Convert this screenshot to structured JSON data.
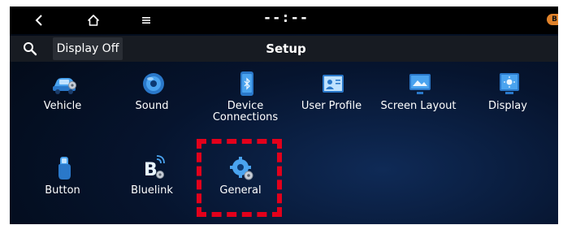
{
  "status_bar": {
    "clock": "--:--",
    "back_icon": "back-chevron-icon",
    "home_icon": "home-icon",
    "menu_icon": "menu-icon",
    "status_icon_letter": "B"
  },
  "title_bar": {
    "search_icon": "search-icon",
    "display_off_label": "Display Off",
    "title": "Setup"
  },
  "menu": {
    "items": [
      {
        "label": "Vehicle",
        "icon": "vehicle-icon"
      },
      {
        "label": "Sound",
        "icon": "speaker-icon"
      },
      {
        "label": "Device\nConnections",
        "icon": "phone-icon"
      },
      {
        "label": "User Profile",
        "icon": "user-profile-icon"
      },
      {
        "label": "Screen Layout",
        "icon": "screen-layout-icon"
      },
      {
        "label": "Display",
        "icon": "display-icon"
      },
      {
        "label": "Button",
        "icon": "button-hand-icon"
      },
      {
        "label": "Bluelink",
        "icon": "bluelink-icon"
      },
      {
        "label": "General",
        "icon": "general-gear-icon"
      }
    ]
  },
  "highlight_color": "#e3001b",
  "accent_color": "#4aa3ef"
}
